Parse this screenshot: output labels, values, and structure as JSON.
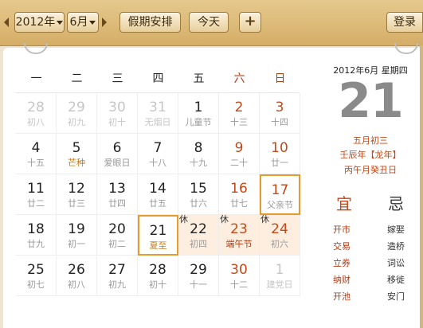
{
  "toolbar": {
    "year": "2012年",
    "month": "6月",
    "holiday_label": "假期安排",
    "today_label": "今天",
    "add_label": "+",
    "login_label": "登录"
  },
  "weekdays": [
    "一",
    "二",
    "三",
    "四",
    "五",
    "六",
    "日"
  ],
  "weeks": [
    [
      {
        "num": "28",
        "sub": "初八",
        "other": true
      },
      {
        "num": "29",
        "sub": "初九",
        "other": true
      },
      {
        "num": "30",
        "sub": "初十",
        "other": true
      },
      {
        "num": "31",
        "sub": "无烟日",
        "other": true
      },
      {
        "num": "1",
        "sub": "儿童节"
      },
      {
        "num": "2",
        "sub": "十三",
        "weekend": true
      },
      {
        "num": "3",
        "sub": "十四",
        "weekend": true
      }
    ],
    [
      {
        "num": "4",
        "sub": "十五"
      },
      {
        "num": "5",
        "sub": "芒种",
        "term": true
      },
      {
        "num": "6",
        "sub": "爱眼日"
      },
      {
        "num": "7",
        "sub": "十八"
      },
      {
        "num": "8",
        "sub": "十九"
      },
      {
        "num": "9",
        "sub": "二十",
        "weekend": true
      },
      {
        "num": "10",
        "sub": "廿一",
        "weekend": true
      }
    ],
    [
      {
        "num": "11",
        "sub": "廿二"
      },
      {
        "num": "12",
        "sub": "廿三"
      },
      {
        "num": "13",
        "sub": "廿四"
      },
      {
        "num": "14",
        "sub": "廿五"
      },
      {
        "num": "15",
        "sub": "廿六"
      },
      {
        "num": "16",
        "sub": "廿七",
        "weekend": true
      },
      {
        "num": "17",
        "sub": "父亲节",
        "weekend": true,
        "selected": true
      }
    ],
    [
      {
        "num": "18",
        "sub": "廿九"
      },
      {
        "num": "19",
        "sub": "初一"
      },
      {
        "num": "20",
        "sub": "初二"
      },
      {
        "num": "21",
        "sub": "夏至",
        "today": true,
        "term": true
      },
      {
        "num": "22",
        "sub": "初四",
        "holiday": true,
        "xiu": "休"
      },
      {
        "num": "23",
        "sub": "端午节",
        "holiday": true,
        "xiu": "休",
        "weekend": true,
        "fest": true
      },
      {
        "num": "24",
        "sub": "初六",
        "holiday": true,
        "xiu": "休",
        "weekend": true
      }
    ],
    [
      {
        "num": "25",
        "sub": "初七"
      },
      {
        "num": "26",
        "sub": "初八"
      },
      {
        "num": "27",
        "sub": "初九"
      },
      {
        "num": "28",
        "sub": "初十"
      },
      {
        "num": "29",
        "sub": "十一"
      },
      {
        "num": "30",
        "sub": "十二",
        "weekend": true
      },
      {
        "num": "1",
        "sub": "建党日",
        "other": true
      }
    ]
  ],
  "side": {
    "date_line": "2012年6月 星期四",
    "day": "21",
    "lunar": "五月初三",
    "ganzhi_year": "壬辰年【龙年】",
    "ganzhi_day": "丙午月癸丑日",
    "yi_title": "宜",
    "ji_title": "忌",
    "yi": [
      "开市",
      "交易",
      "立券",
      "纳财",
      "开池"
    ],
    "ji": [
      "嫁娶",
      "造桥",
      "词讼",
      "移徙",
      "安门"
    ]
  },
  "colors": {
    "accent": "#c2491a",
    "selected_border": "#e79a2e",
    "holiday_bg": "#fdeee0"
  }
}
